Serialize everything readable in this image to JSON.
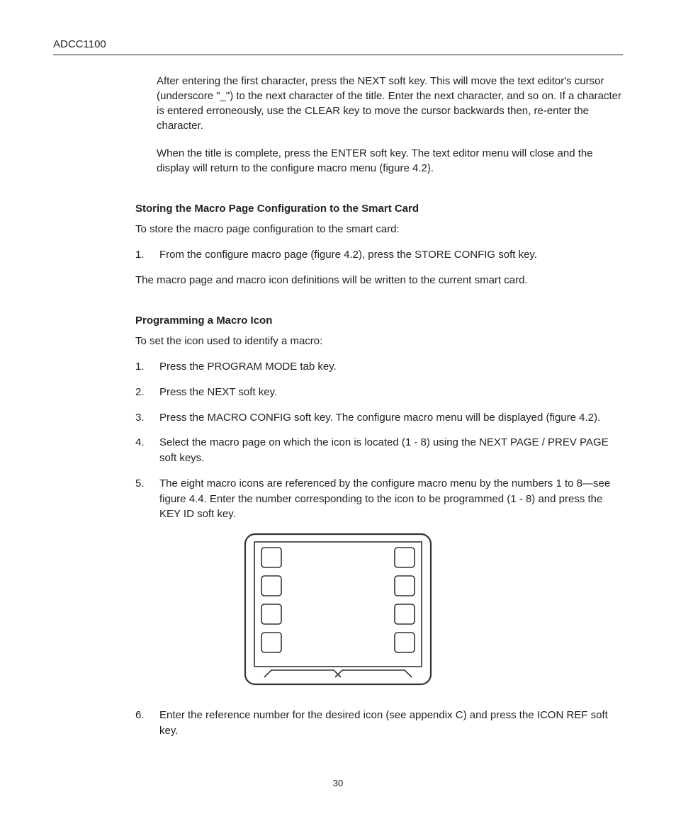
{
  "header": {
    "title": "ADCC1100"
  },
  "intro": {
    "p1": "After entering the first character, press the NEXT soft key. This will move the text editor's cursor (underscore \"_\") to the next character of the title. Enter the next character, and so on. If a character is entered erroneously, use the CLEAR key to move the cursor backwards then, re-enter the character.",
    "p2": "When the title is complete, press the ENTER soft key. The text editor menu will close and the display will return to the configure macro menu (figure 4.2)."
  },
  "section1": {
    "heading": "Storing the Macro Page Configuration to the Smart Card",
    "lead": "To store the macro page configuration to the smart card:",
    "steps": [
      "From the configure macro page (figure 4.2), press the STORE CONFIG soft key."
    ],
    "tail": "The macro page and macro icon definitions will be written to the current smart card."
  },
  "section2": {
    "heading": "Programming a Macro Icon",
    "lead": "To set the icon used to identify a macro:",
    "steps": [
      "Press the PROGRAM MODE tab key.",
      "Press the NEXT soft key.",
      "Press the MACRO CONFIG soft key. The configure macro menu will be displayed (figure 4.2).",
      "Select the macro page on which the icon is located (1 - 8) using the NEXT PAGE / PREV PAGE soft keys.",
      "The eight macro icons are referenced by the configure macro menu by the numbers 1 to 8—see figure 4.4. Enter the number corresponding to the icon to be programmed (1 - 8) and press the KEY ID soft key."
    ],
    "steps_after_figure": [
      "Enter the reference number for the desired icon (see appendix C) and press the ICON REF soft key."
    ]
  },
  "page_number": "30"
}
